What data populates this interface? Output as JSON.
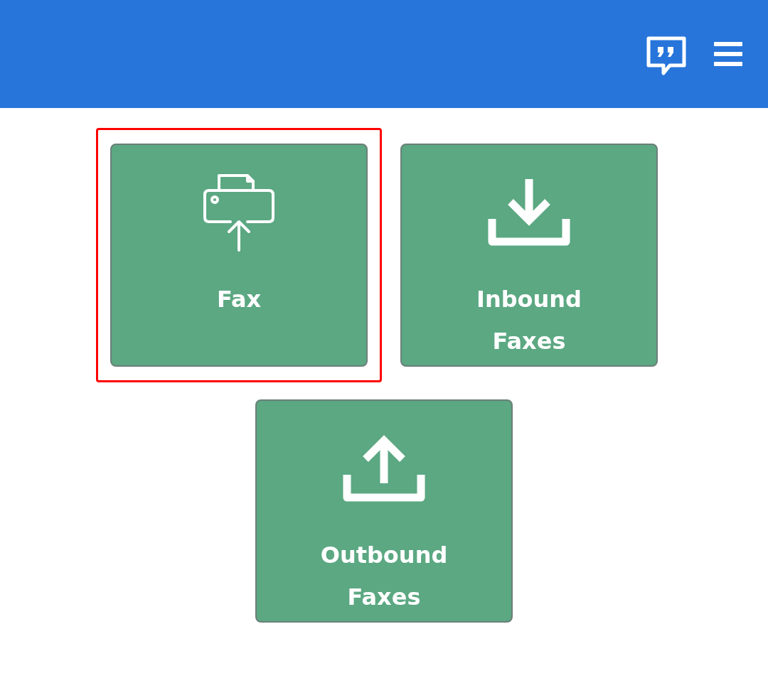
{
  "header": {
    "buttons": [
      {
        "kind": "feedback"
      },
      {
        "kind": "menu"
      }
    ]
  },
  "tiles": [
    {
      "label": "Fax",
      "kind": "fax",
      "highlighted": true
    },
    {
      "label": "Inbound Faxes",
      "kind": "download",
      "highlighted": false
    },
    {
      "label": "Outbound Faxes",
      "kind": "upload",
      "highlighted": false
    }
  ]
}
